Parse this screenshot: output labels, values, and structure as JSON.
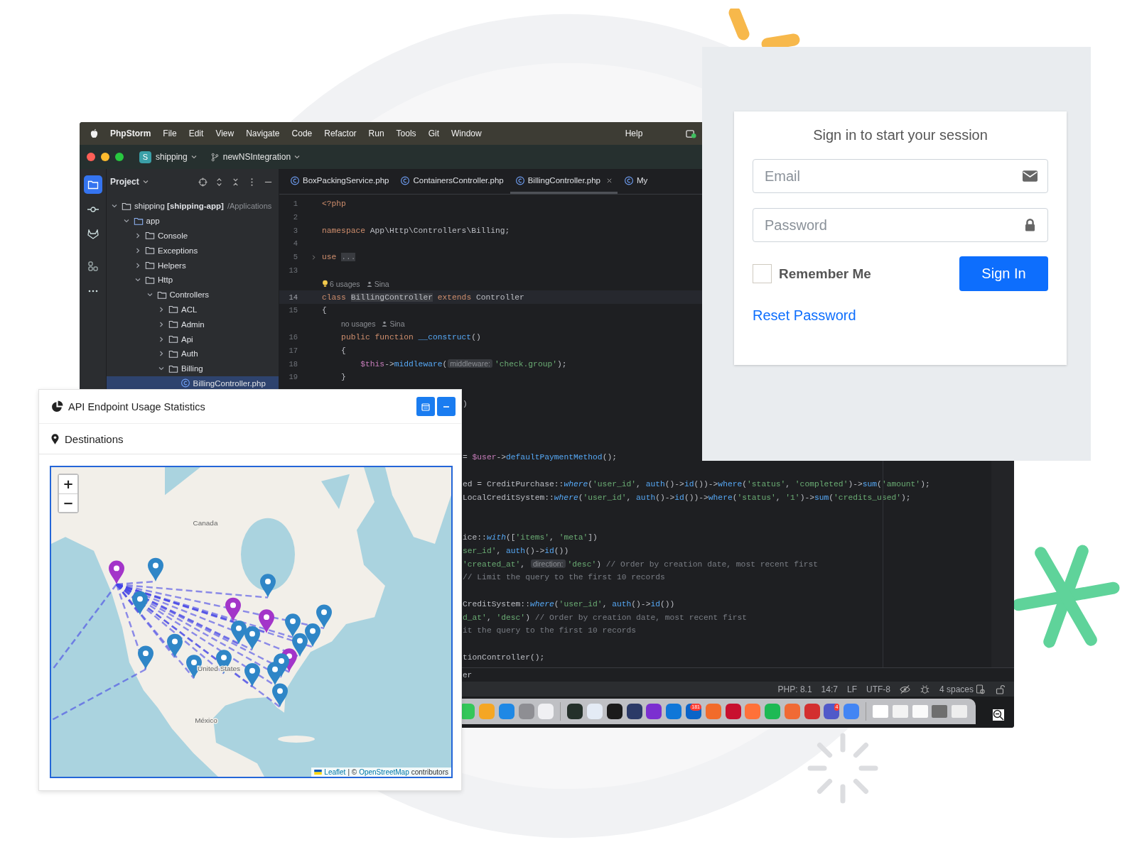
{
  "ide": {
    "menu_bar": {
      "app_name": "PhpStorm",
      "items": [
        "File",
        "Edit",
        "View",
        "Navigate",
        "Code",
        "Refactor",
        "Run",
        "Tools",
        "Git",
        "Window"
      ],
      "help": "Help"
    },
    "title_bar": {
      "project_badge": "S",
      "project": "shipping",
      "branch": "newNSIntegration"
    },
    "tool_strip": [
      {
        "kind": "project",
        "selected": true
      },
      {
        "kind": "commit",
        "selected": false
      },
      {
        "kind": "gitlab",
        "selected": false
      },
      {
        "kind": "structure",
        "selected": false
      },
      {
        "kind": "more",
        "selected": false
      }
    ],
    "project_panel": {
      "title": "Project",
      "tree": [
        {
          "kind": "folder",
          "name": "shipping **[shipping-app]**",
          "path": "/Applications",
          "expanded": true,
          "selected": false,
          "children": [
            {
              "kind": "folder",
              "name": "app",
              "expanded": true,
              "selected": false,
              "children": [
                {
                  "kind": "folder",
                  "name": "Console",
                  "expanded": false,
                  "selected": false
                },
                {
                  "kind": "folder",
                  "name": "Exceptions",
                  "expanded": false,
                  "selected": false
                },
                {
                  "kind": "folder",
                  "name": "Helpers",
                  "expanded": false,
                  "selected": false
                },
                {
                  "kind": "folder",
                  "name": "Http",
                  "expanded": true,
                  "selected": false,
                  "children": [
                    {
                      "kind": "folder",
                      "name": "Controllers",
                      "expanded": true,
                      "selected": false,
                      "children": [
                        {
                          "kind": "folder",
                          "name": "ACL",
                          "expanded": false,
                          "selected": false
                        },
                        {
                          "kind": "folder",
                          "name": "Admin",
                          "expanded": false,
                          "selected": false
                        },
                        {
                          "kind": "folder",
                          "name": "Api",
                          "expanded": false,
                          "selected": false
                        },
                        {
                          "kind": "folder",
                          "name": "Auth",
                          "expanded": false,
                          "selected": false
                        },
                        {
                          "kind": "folder",
                          "name": "Billing",
                          "expanded": true,
                          "selected": false,
                          "children": [
                            {
                              "kind": "file",
                              "name": "BillingController.php",
                              "selected": true
                            }
                          ]
                        }
                      ]
                    }
                  ]
                }
              ]
            }
          ]
        }
      ]
    },
    "tabs": [
      {
        "label": "BoxPackingService.php",
        "selected": false,
        "closable": false
      },
      {
        "label": "ContainersController.php",
        "selected": false,
        "closable": false
      },
      {
        "label": "BillingController.php",
        "selected": true,
        "closable": true
      },
      {
        "label": "My",
        "selected": false,
        "closable": false
      }
    ],
    "code_lines": [
      {
        "kind": "code",
        "number": "1",
        "current": false,
        "tokens": [
          {
            "text": "<?php",
            "kind": "kw"
          }
        ]
      },
      {
        "kind": "code",
        "number": "2",
        "current": false
      },
      {
        "kind": "code",
        "number": "3",
        "current": false,
        "tokens": [
          {
            "text": "namespace ",
            "kind": "kw"
          },
          {
            "text": "App\\Http\\Controllers\\Billing;",
            "kind": "pl"
          }
        ]
      },
      {
        "kind": "code",
        "number": "4",
        "current": false
      },
      {
        "kind": "collapsed",
        "number": "5",
        "current": false,
        "tokens": [
          {
            "text": "use ",
            "kind": "kw"
          },
          {
            "text": "...",
            "kind": "fold"
          }
        ]
      },
      {
        "kind": "code",
        "number": "13",
        "current": false
      },
      {
        "kind": "inlay",
        "usages": "6 usages",
        "author": "Sina",
        "bulb": true
      },
      {
        "kind": "code",
        "number": "14",
        "current": true,
        "tokens": [
          {
            "text": "class ",
            "kind": "kw"
          },
          {
            "text": "BillingController",
            "kind": "hl"
          },
          {
            "text": " extends ",
            "kind": "kw"
          },
          {
            "text": "Controller",
            "kind": "pl"
          }
        ]
      },
      {
        "kind": "code",
        "number": "15",
        "current": false,
        "tokens": [
          {
            "text": "{",
            "kind": "pl"
          }
        ]
      },
      {
        "kind": "inlay",
        "usages": "no usages",
        "author": "Sina",
        "bulb": false
      },
      {
        "kind": "code",
        "number": "16",
        "current": false,
        "tokens": [
          {
            "text": "public function ",
            "kind": "kw"
          },
          {
            "text": "__construct",
            "kind": "fn"
          },
          {
            "text": "()",
            "kind": "pl"
          }
        ]
      },
      {
        "kind": "code",
        "number": "17",
        "current": false,
        "tokens": [
          {
            "text": "{",
            "kind": "pl"
          }
        ]
      },
      {
        "kind": "code",
        "number": "18",
        "current": false,
        "tokens": [
          {
            "text": "$this",
            "kind": "var"
          },
          {
            "text": "->",
            "kind": "pl"
          },
          {
            "text": "middleware",
            "kind": "fn"
          },
          {
            "text": "(",
            "kind": "pl"
          },
          {
            "text": "middleware:",
            "kind": "hint"
          },
          {
            "text": "'check.group'",
            "kind": "str"
          },
          {
            "text": ");",
            "kind": "pl"
          }
        ]
      },
      {
        "kind": "code",
        "number": "19",
        "current": false,
        "tokens": [
          {
            "text": "}",
            "kind": "pl"
          }
        ]
      }
    ],
    "code_fragments": [
      [
        [
          {
            "text": ")",
            "kind": "pl"
          }
        ]
      ],
      [
        [
          {
            "text": "= ",
            "kind": "pl"
          },
          {
            "text": "$user",
            "kind": "var"
          },
          {
            "text": "->",
            "kind": "pl"
          },
          {
            "text": "defaultPaymentMethod",
            "kind": "fn"
          },
          {
            "text": "();",
            "kind": "pl"
          }
        ]
      ],
      [
        [
          {
            "text": "ed = CreditPurchase::",
            "kind": "pl"
          },
          {
            "text": "where",
            "kind": "fni"
          },
          {
            "text": "(",
            "kind": "pl"
          },
          {
            "text": "'user_id'",
            "kind": "str"
          },
          {
            "text": ", ",
            "kind": "pl"
          },
          {
            "text": "auth",
            "kind": "fn"
          },
          {
            "text": "()->",
            "kind": "pl"
          },
          {
            "text": "id",
            "kind": "fn"
          },
          {
            "text": "())->",
            "kind": "pl"
          },
          {
            "text": "where",
            "kind": "fn"
          },
          {
            "text": "(",
            "kind": "pl"
          },
          {
            "text": "'status'",
            "kind": "str"
          },
          {
            "text": ", ",
            "kind": "pl"
          },
          {
            "text": "'completed'",
            "kind": "str"
          },
          {
            "text": ")->",
            "kind": "pl"
          },
          {
            "text": "sum",
            "kind": "fn"
          },
          {
            "text": "(",
            "kind": "pl"
          },
          {
            "text": "'amount'",
            "kind": "str"
          },
          {
            "text": ");",
            "kind": "pl"
          }
        ],
        [
          {
            "text": "LocalCreditSystem::",
            "kind": "pl"
          },
          {
            "text": "where",
            "kind": "fni"
          },
          {
            "text": "(",
            "kind": "pl"
          },
          {
            "text": "'user_id'",
            "kind": "str"
          },
          {
            "text": ", ",
            "kind": "pl"
          },
          {
            "text": "auth",
            "kind": "fn"
          },
          {
            "text": "()->",
            "kind": "pl"
          },
          {
            "text": "id",
            "kind": "fn"
          },
          {
            "text": "())->",
            "kind": "pl"
          },
          {
            "text": "where",
            "kind": "fn"
          },
          {
            "text": "(",
            "kind": "pl"
          },
          {
            "text": "'status'",
            "kind": "str"
          },
          {
            "text": ", ",
            "kind": "pl"
          },
          {
            "text": "'1'",
            "kind": "str"
          },
          {
            "text": ")->",
            "kind": "pl"
          },
          {
            "text": "sum",
            "kind": "fn"
          },
          {
            "text": "(",
            "kind": "pl"
          },
          {
            "text": "'credits_used'",
            "kind": "str"
          },
          {
            "text": ");",
            "kind": "pl"
          }
        ]
      ],
      [
        [
          {
            "text": "ice::",
            "kind": "pl"
          },
          {
            "text": "with",
            "kind": "fni"
          },
          {
            "text": "([",
            "kind": "pl"
          },
          {
            "text": "'items'",
            "kind": "str"
          },
          {
            "text": ", ",
            "kind": "pl"
          },
          {
            "text": "'meta'",
            "kind": "str"
          },
          {
            "text": "])",
            "kind": "pl"
          }
        ],
        [
          {
            "text": "ser_id'",
            "kind": "str"
          },
          {
            "text": ", ",
            "kind": "pl"
          },
          {
            "text": "auth",
            "kind": "fn"
          },
          {
            "text": "()->",
            "kind": "pl"
          },
          {
            "text": "id",
            "kind": "fn"
          },
          {
            "text": "())",
            "kind": "pl"
          }
        ],
        [
          {
            "text": "'created_at'",
            "kind": "str"
          },
          {
            "text": ", ",
            "kind": "pl"
          },
          {
            "text": "direction:",
            "kind": "hint"
          },
          {
            "text": "'desc'",
            "kind": "str"
          },
          {
            "text": ") ",
            "kind": "pl"
          },
          {
            "text": "// Order by creation date, most recent first",
            "kind": "cm"
          }
        ],
        [
          {
            "text": "// Limit the query to the first 10 records",
            "kind": "cm"
          }
        ]
      ],
      [
        [
          {
            "text": "CreditSystem::",
            "kind": "pl"
          },
          {
            "text": "where",
            "kind": "fni"
          },
          {
            "text": "(",
            "kind": "pl"
          },
          {
            "text": "'user_id'",
            "kind": "str"
          },
          {
            "text": ", ",
            "kind": "pl"
          },
          {
            "text": "auth",
            "kind": "fn"
          },
          {
            "text": "()->",
            "kind": "pl"
          },
          {
            "text": "id",
            "kind": "fn"
          },
          {
            "text": "())",
            "kind": "pl"
          }
        ],
        [
          {
            "text": "d_at'",
            "kind": "str"
          },
          {
            "text": ", ",
            "kind": "pl"
          },
          {
            "text": "'desc'",
            "kind": "str"
          },
          {
            "text": ") ",
            "kind": "pl"
          },
          {
            "text": "// Order by creation date, most recent first",
            "kind": "cm"
          }
        ],
        [
          {
            "text": "it the query to the first 10 records",
            "kind": "cm"
          }
        ]
      ],
      [
        [
          {
            "text": "tionController();",
            "kind": "pl"
          }
        ]
      ]
    ],
    "bottom_panel_text": "er",
    "status_bar": {
      "items": [
        "PHP: 8.1",
        "14:7",
        "LF",
        "UTF-8"
      ],
      "indent": "4 spaces"
    },
    "dock": [
      {
        "kind": "app",
        "color": "#34c759"
      },
      {
        "kind": "app",
        "color": "#f5a623"
      },
      {
        "kind": "app",
        "color": "#1e88e5"
      },
      {
        "kind": "app",
        "color": "#8e8e93"
      },
      {
        "kind": "app",
        "color": "#f0f0f3"
      },
      {
        "kind": "separator"
      },
      {
        "kind": "app",
        "color": "#24302a"
      },
      {
        "kind": "app",
        "color": "#e4ebf5"
      },
      {
        "kind": "app",
        "color": "#1b1b1b"
      },
      {
        "kind": "app",
        "color": "#2b3a67"
      },
      {
        "kind": "app",
        "color": "#7b2fd0"
      },
      {
        "kind": "app",
        "color": "#0f77d8"
      },
      {
        "kind": "app",
        "color": "#0a64c8",
        "badge": "181"
      },
      {
        "kind": "app",
        "color": "#f26b2a"
      },
      {
        "kind": "app",
        "color": "#c8102e"
      },
      {
        "kind": "app",
        "color": "#ff7139"
      },
      {
        "kind": "app",
        "color": "#1db954"
      },
      {
        "kind": "app",
        "color": "#f06a35"
      },
      {
        "kind": "app",
        "color": "#d32f2f"
      },
      {
        "kind": "app",
        "color": "#5059c9",
        "badge": "4"
      },
      {
        "kind": "app",
        "color": "#4285f4"
      },
      {
        "kind": "separator"
      },
      {
        "kind": "document",
        "color": "#ffffff"
      },
      {
        "kind": "document",
        "color": "#f3f3f3"
      },
      {
        "kind": "document",
        "color": "#fafafa"
      },
      {
        "kind": "document",
        "color": "#6e6e6e"
      },
      {
        "kind": "document",
        "color": "#eeeeee"
      }
    ]
  },
  "map_card": {
    "title": "API Endpoint Usage Statistics",
    "section": "Destinations",
    "zoom_in": "+",
    "zoom_out": "−",
    "labels": [
      "Canada",
      "United States",
      "México"
    ],
    "markers": [
      {
        "color": "#a335c9"
      },
      {
        "color": "#2f86c7"
      },
      {
        "color": "#2f86c7"
      },
      {
        "color": "#2f86c7"
      },
      {
        "color": "#a335c9"
      },
      {
        "color": "#a335c9"
      },
      {
        "color": "#2f86c7"
      },
      {
        "color": "#2f86c7"
      },
      {
        "color": "#2f86c7"
      },
      {
        "color": "#2f86c7"
      },
      {
        "color": "#2f86c7"
      },
      {
        "color": "#2f86c7"
      },
      {
        "color": "#a335c9"
      },
      {
        "color": "#2f86c7"
      },
      {
        "color": "#2f86c7"
      },
      {
        "color": "#2f86c7"
      },
      {
        "color": "#2f86c7"
      },
      {
        "color": "#2f86c7"
      },
      {
        "color": "#2f86c7"
      },
      {
        "color": "#2f86c7"
      },
      {
        "color": "#2f86c7"
      }
    ],
    "attribution": {
      "leaflet": "Leaflet",
      "middle": "| ©",
      "osm": "OpenStreetMap",
      "suffix": "contributors"
    }
  },
  "login": {
    "title": "Sign in to start your session",
    "fields": [
      {
        "kind": "email",
        "placeholder": "Email"
      },
      {
        "kind": "password",
        "placeholder": "Password"
      }
    ],
    "remember": {
      "label": "Remember Me",
      "checked": false
    },
    "submit": "Sign In",
    "reset_link": "Reset Password"
  }
}
